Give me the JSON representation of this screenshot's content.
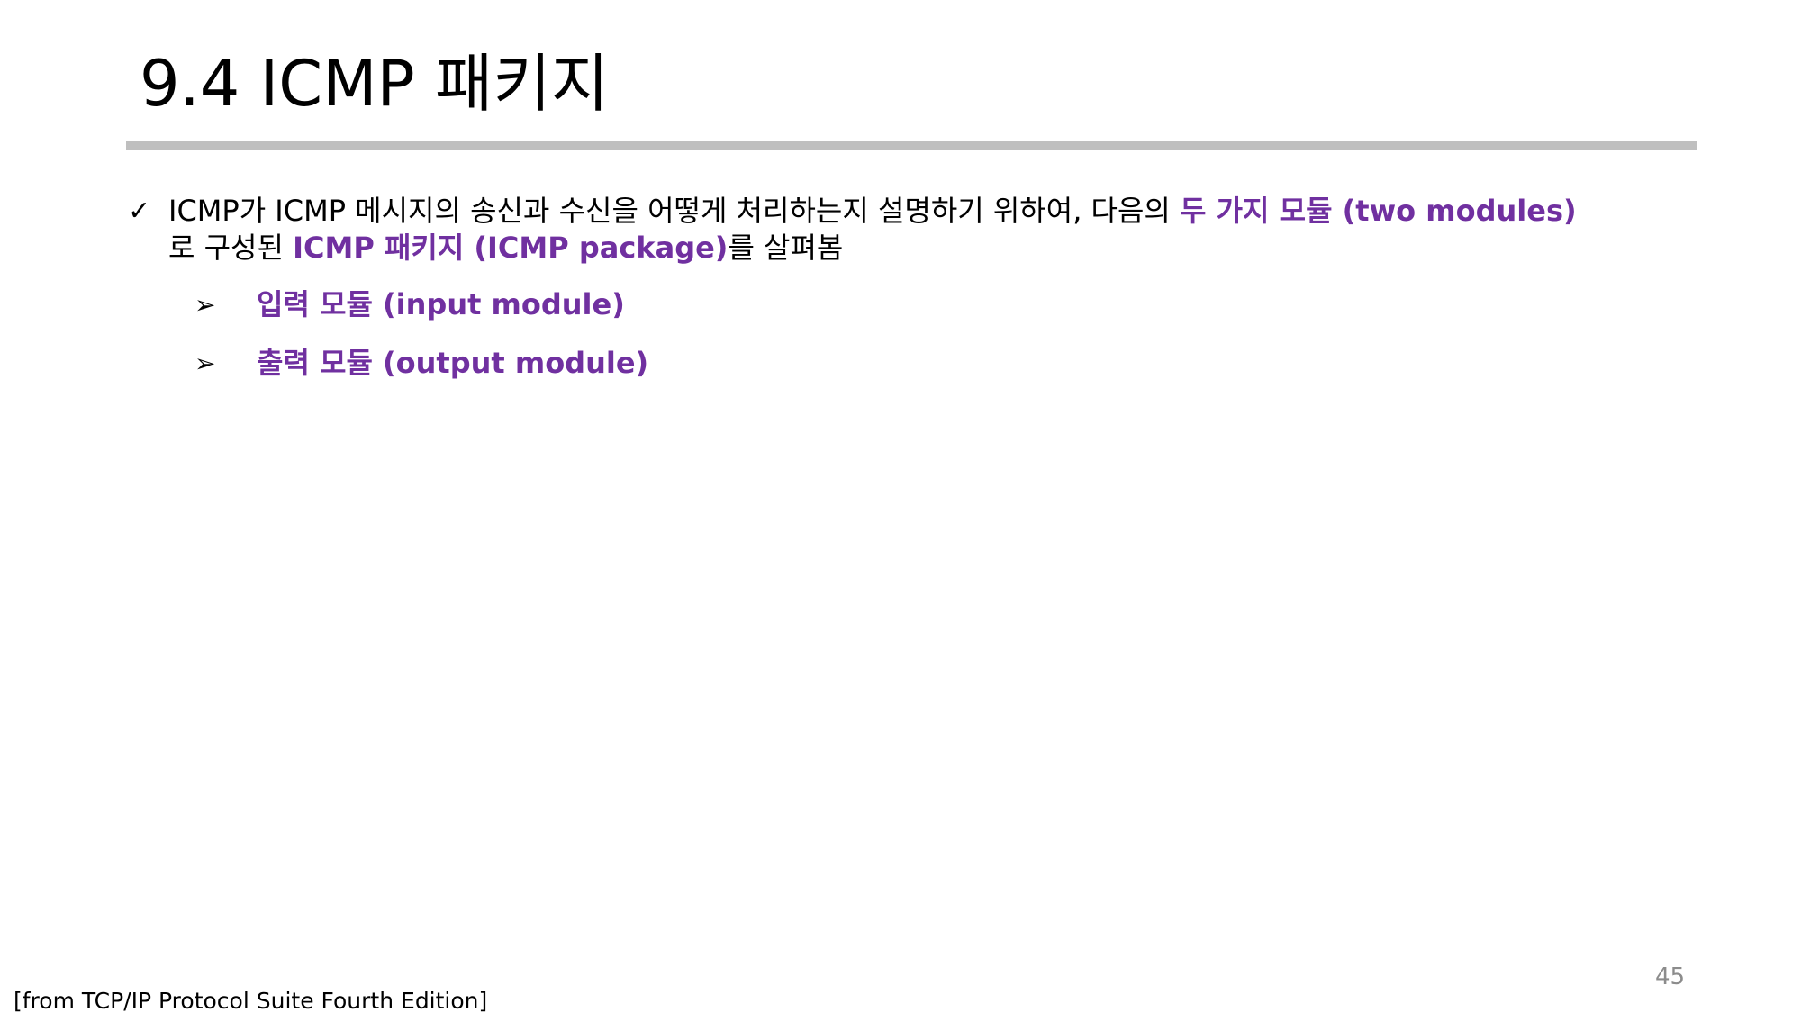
{
  "slide": {
    "title": "9.4 ICMP 패키지",
    "main_bullet": {
      "icon": "check-icon",
      "part1": "ICMP가 ICMP 메시지의 송신과 수신을 어떻게 처리하는지 설명하기 위하여, 다음의 ",
      "part2_highlight": "두 가지 모듈 (two modules)",
      "part3": "로 구성된 ",
      "part4_highlight": "ICMP 패키지 (ICMP package)",
      "part5": "를 살펴봄"
    },
    "sub_items": [
      {
        "icon": "arrow-bullet-icon",
        "label": "입력 모듈 (input module)"
      },
      {
        "icon": "arrow-bullet-icon",
        "label": "출력 모듈 (output module)"
      }
    ],
    "page_number": "45",
    "source": "[from TCP/IP Protocol Suite Fourth Edition]",
    "colors": {
      "highlight": "#7030a0",
      "rule": "#bfbfbf",
      "page_number": "#8c8c8c"
    }
  }
}
